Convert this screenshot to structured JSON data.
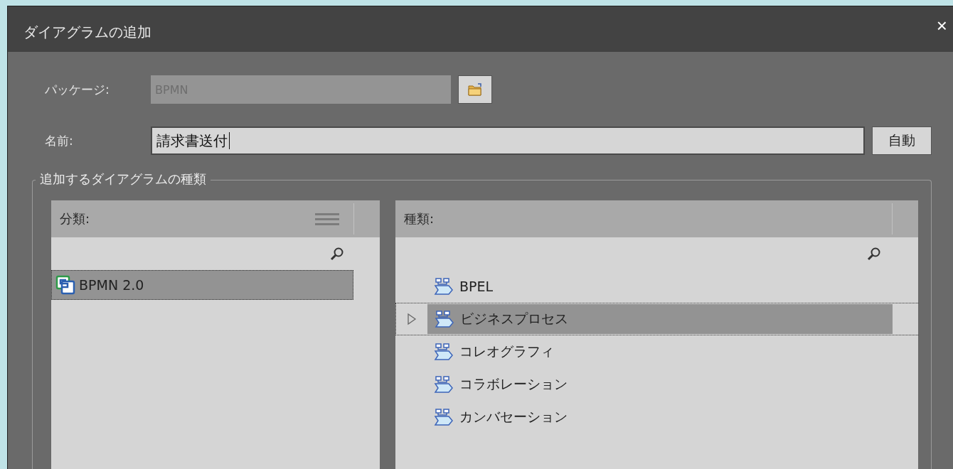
{
  "window": {
    "title": "ダイアグラムの追加",
    "close": "×"
  },
  "package": {
    "label": "パッケージ:",
    "value": "BPMN",
    "disabled": true
  },
  "name": {
    "label": "名前:",
    "value": "請求書送付",
    "button": "自動"
  },
  "group": {
    "title": "追加するダイアグラムの種類",
    "categories": {
      "header": "分類:",
      "items": [
        {
          "label": "BPMN 2.0",
          "selected": true
        }
      ]
    },
    "types": {
      "header": "種類:",
      "items": [
        {
          "label": "BPEL",
          "selected": false
        },
        {
          "label": "ビジネスプロセス",
          "selected": true
        },
        {
          "label": "コレオグラフィ",
          "selected": false
        },
        {
          "label": "コラボレーション",
          "selected": false
        },
        {
          "label": "カンバセーション",
          "selected": false
        }
      ]
    }
  }
}
